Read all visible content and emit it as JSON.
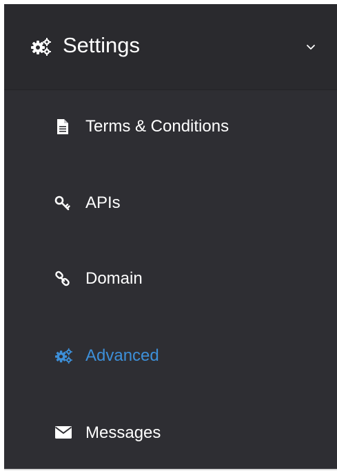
{
  "colors": {
    "header_bg": "#2a2a2e",
    "menu_bg": "#2e2e33",
    "text": "#ffffff",
    "accent": "#3d8fd8"
  },
  "header": {
    "title": "Settings",
    "icon": "cogs-icon",
    "chevron": "chevron-down-icon"
  },
  "menu": {
    "items": [
      {
        "label": "Terms & Conditions",
        "icon": "file-text-icon",
        "active": false
      },
      {
        "label": "APIs",
        "icon": "key-icon",
        "active": false
      },
      {
        "label": "Domain",
        "icon": "link-icon",
        "active": false
      },
      {
        "label": "Advanced",
        "icon": "cogs-icon",
        "active": true
      },
      {
        "label": "Messages",
        "icon": "envelope-icon",
        "active": false
      }
    ]
  }
}
